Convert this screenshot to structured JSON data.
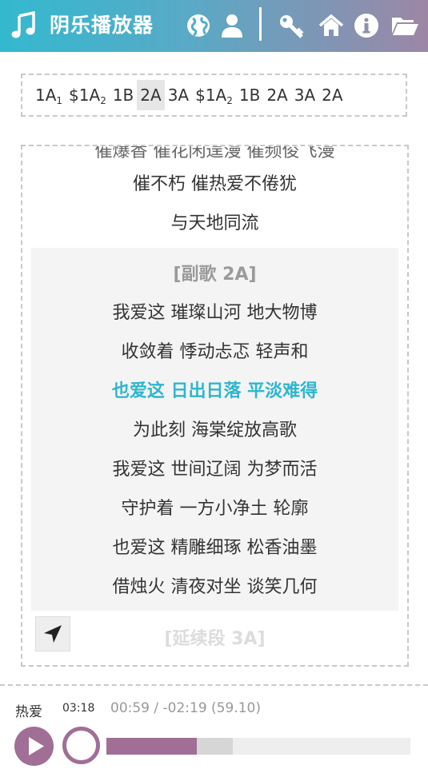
{
  "header": {
    "title": "阴乐播放器",
    "icons": [
      "music-note-icon",
      "globe-icon",
      "user-icon",
      "key-icon",
      "home-icon",
      "info-icon",
      "folder-open-icon"
    ],
    "accent_start": "#33b9cf",
    "accent_end": "#9d86a6"
  },
  "sequence": [
    {
      "main": "1A",
      "sub": "1",
      "active": false
    },
    {
      "main": "$1A",
      "sub": "2",
      "active": false
    },
    {
      "main": "1B",
      "sub": "",
      "active": false
    },
    {
      "main": "2A",
      "sub": "",
      "active": true
    },
    {
      "main": "3A",
      "sub": "",
      "active": false
    },
    {
      "main": "$1A",
      "sub": "2",
      "active": false
    },
    {
      "main": "1B",
      "sub": "",
      "active": false
    },
    {
      "main": "2A",
      "sub": "",
      "active": false
    },
    {
      "main": "3A",
      "sub": "",
      "active": false
    },
    {
      "main": "2A",
      "sub": "",
      "active": false
    }
  ],
  "lyrics": {
    "before": [
      "催不朽 催热爱不倦犹",
      "与天地同流"
    ],
    "section_label": "[副歌 2A]",
    "section_lines": [
      "我爱这 璀璨山河 地大物博",
      "收敛着 悸动忐忑 轻声和",
      "也爱这 日出日落 平淡难得",
      "为此刻 海棠绽放高歌",
      "我爱这 世间辽阔 为梦而活",
      "守护着 一方小净土 轮廓",
      "也爱这 精雕细琢 松香油墨",
      "借烛火 清夜对坐 谈笑几何"
    ],
    "highlight_index": 2,
    "next_label": "[延续段 3A]",
    "highlight_color": "#2eb6ce"
  },
  "player": {
    "title": "热爱",
    "duration": "03:18",
    "time": "00:59 / -02:19 (59.10)",
    "progress_fraction": 0.298,
    "buffer_fraction": 0.415,
    "accent": "#a16e95"
  }
}
